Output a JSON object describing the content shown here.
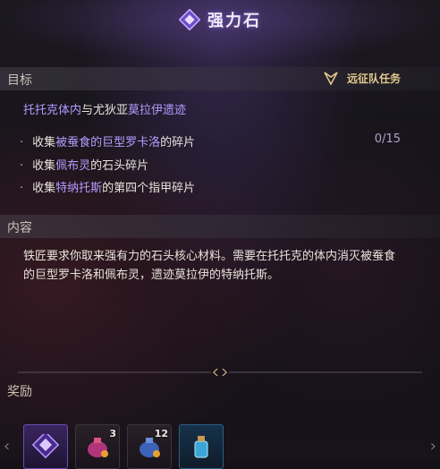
{
  "window": {
    "title": "强力石"
  },
  "target": {
    "section_label": "目标",
    "quest_type": "远征队任务",
    "location": {
      "part1": "托托克体内",
      "connector": "与尤狄亚",
      "part2": "莫拉伊遗迹"
    },
    "objectives": [
      {
        "prefix": "收集",
        "name": "被蚕食的巨型罗卡洛",
        "suffix": "的碎片",
        "progress": "0/15"
      },
      {
        "prefix": "收集",
        "name": "佩布灵",
        "suffix": "的石头碎片",
        "progress": ""
      },
      {
        "prefix": "收集",
        "name": "特纳托斯",
        "suffix": "的第四个指甲碎片",
        "progress": ""
      }
    ]
  },
  "content": {
    "section_label": "内容",
    "description": "铁匠要求你取来强有力的石头核心材料。需要在托托克的体内消灭被蚕食的巨型罗卡洛和佩布灵，遗迹莫拉伊的特纳托斯。"
  },
  "rewards": {
    "section_label": "奖励",
    "items": [
      {
        "icon": "purple-crystal-icon",
        "count": ""
      },
      {
        "icon": "pouch-red-icon",
        "count": "3"
      },
      {
        "icon": "pouch-blue-icon",
        "count": "12"
      },
      {
        "icon": "potion-bottle-icon",
        "count": ""
      }
    ]
  },
  "colors": {
    "highlight": "#b59cff",
    "quest_type": "#e3c98c",
    "accent": "#7a55d6"
  }
}
